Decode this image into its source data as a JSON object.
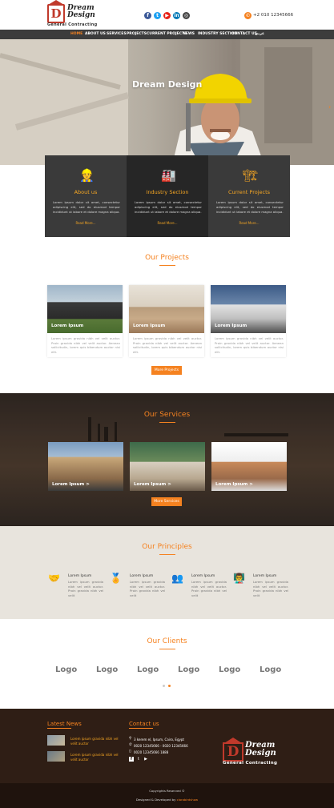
{
  "brand": {
    "name_line1": "Dream",
    "name_line2": "Design",
    "letter": "D",
    "sub": "General Contracting"
  },
  "header": {
    "phone": "+2 010 12345666",
    "socials": [
      {
        "icon": "facebook-icon",
        "glyph": "f",
        "color": "#3b5998"
      },
      {
        "icon": "twitter-icon",
        "glyph": "t",
        "color": "#1da1f2"
      },
      {
        "icon": "youtube-icon",
        "glyph": "▶",
        "color": "#e62117"
      },
      {
        "icon": "linkedin-icon",
        "glyph": "in",
        "color": "#0077b5"
      },
      {
        "icon": "instagram-icon",
        "glyph": "◎",
        "color": "#444444"
      }
    ]
  },
  "nav": {
    "items": [
      "HOME",
      "ABOUT US",
      "SERVICES",
      "PROJECTS",
      "CURRENT PROJECTS",
      "NEWS",
      "INDUSTRY SECTION",
      "CONTACT US",
      "عربي"
    ]
  },
  "hero": {
    "title": "Dream Design"
  },
  "features": [
    {
      "title": "About us",
      "icon": "team-icon",
      "text": "Lorem ipsum dolor sit amet, consectetur adipiscing elit, sed do eiusmod tempor incididunt ut labore et dolore magna aliqua.",
      "more": "Read More..."
    },
    {
      "title": "Industry Section",
      "icon": "factory-icon",
      "text": "Lorem ipsum dolor sit amet, consectetur adipiscing elit, sed do eiusmod tempor incididunt ut labore et dolore magna aliqua.",
      "more": "Read More..."
    },
    {
      "title": "Current Projects",
      "icon": "crane-icon",
      "text": "Lorem ipsum dolor sit amet, consectetur adipiscing elit, sed do eiusmod tempor incididunt ut labore et dolore magna aliqua.",
      "more": "Read More..."
    }
  ],
  "projects": {
    "title": "Our Projects",
    "button": "More Projects",
    "cards": [
      {
        "label": "Lorem Ipsum",
        "text": "Lorem ipsum gravida nibh vel velit auctor. Proin gravida nibh vel velit auctor. Aenean sollicitudin, lorem quis bibendum auctor nisi elit."
      },
      {
        "label": "Lorem Ipsum",
        "text": "Lorem ipsum gravida nibh vel velit auctor. Proin gravida nibh vel velit auctor. Aenean sollicitudin, lorem quis bibendum auctor nisi elit."
      },
      {
        "label": "Lorem Ipsum",
        "text": "Lorem ipsum gravida nibh vel velit auctor. Proin gravida nibh vel velit auctor. Aenean sollicitudin, lorem quis bibendum auctor nisi elit."
      }
    ]
  },
  "services": {
    "title": "Our Services",
    "button": "More Services",
    "cards": [
      {
        "label": "Lorem Ipsum >"
      },
      {
        "label": "Lorem Ipsum >"
      },
      {
        "label": "Lorem Ipsum >"
      }
    ]
  },
  "principles": {
    "title": "Our Principles",
    "items": [
      {
        "icon": "handshake-icon",
        "title": "Lorem Ipsum",
        "text": "Lorem ipsum gravida nibh vel velit auctor. Proin gravida nibh vel velit"
      },
      {
        "icon": "medal-icon",
        "title": "Lorem Ipsum",
        "text": "Lorem ipsum gravida nibh vel velit auctor. Proin gravida nibh vel velit"
      },
      {
        "icon": "group-icon",
        "title": "Lorem Ipsum",
        "text": "Lorem ipsum gravida nibh vel velit auctor. Proin gravida nibh vel velit"
      },
      {
        "icon": "presenter-icon",
        "title": "Lorem Ipsum",
        "text": "Lorem ipsum gravida nibh vel velit auctor. Proin gravida nibh vel velit"
      }
    ]
  },
  "clients": {
    "title": "Our Clients",
    "logos": [
      "Logo",
      "Logo",
      "Logo",
      "Logo",
      "Logo",
      "Logo"
    ]
  },
  "footer": {
    "news_title": "Latest News",
    "news": [
      {
        "text": "Lorem ipsum gravida nibh vel velit auctor"
      },
      {
        "text": "Lorem ipsum gravida nibh vel velit auctor"
      }
    ],
    "contact_title": "Contact us",
    "address": "3 kerem el, Ipsum, Cairo, Egypt",
    "phones1": "0020 12345666 - 0020 12345666",
    "phones2": "0020 12345666 1888",
    "copyright": "Copyrights Reserved ©",
    "developer_prefix": "Designed & Developed by",
    "developer": "clarabirdshow"
  }
}
